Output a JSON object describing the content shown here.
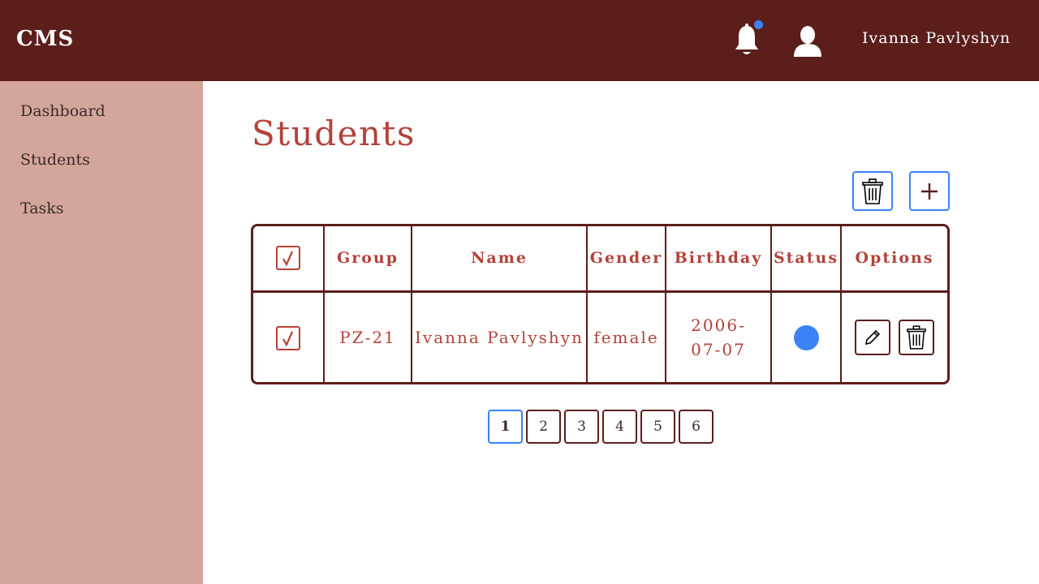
{
  "header": {
    "logo": "CMS",
    "username": "Ivanna Pavlyshyn",
    "icons": [
      "bell-icon",
      "user-icon"
    ]
  },
  "sidebar": {
    "items": [
      {
        "label": "Dashboard"
      },
      {
        "label": "Students"
      },
      {
        "label": "Tasks"
      }
    ]
  },
  "main": {
    "title": "Students",
    "toolbar_icons": [
      "trash-icon",
      "plus-icon"
    ]
  },
  "table": {
    "headers": [
      "Group",
      "Name",
      "Gender",
      "Birthday",
      "Status",
      "Options"
    ],
    "rows": [
      {
        "group": "PZ-21",
        "name": "Ivanna Pavlyshyn",
        "gender": "female",
        "birthday": "2006-07-07",
        "status": "active"
      }
    ]
  },
  "pagination": {
    "pages": [
      "1",
      "2",
      "3",
      "4",
      "5",
      "6"
    ],
    "current": "1"
  },
  "colors": {
    "header_bg": "#5c1e1b",
    "sidebar_bg": "#d4a69b",
    "accent": "#b3423a",
    "status_active": "#3b82f6"
  }
}
